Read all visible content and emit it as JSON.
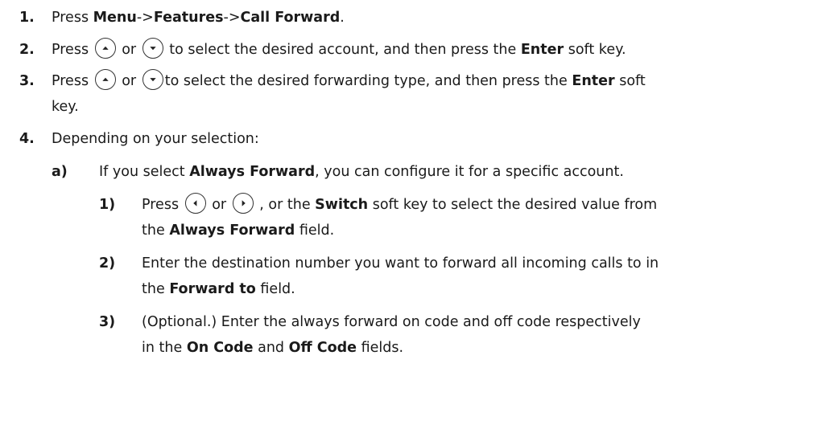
{
  "icons": {
    "up": "arrow-up-key-icon",
    "down": "arrow-down-key-icon",
    "left": "arrow-left-key-icon",
    "right": "arrow-right-key-icon"
  },
  "steps": [
    {
      "number": "1.",
      "press": "Press",
      "menu": "Menu",
      "sep1": "->",
      "features": "Features",
      "sep2": "->",
      "call_forward": "Call Forward",
      "end": "."
    },
    {
      "number": "2.",
      "press": "Press",
      "or": "or",
      "text": "to select the desired account, and then press the",
      "enter": "Enter",
      "end": "soft key."
    },
    {
      "number": "3.",
      "press": "Press",
      "or": "or",
      "text": "to select the desired forwarding type, and then press the",
      "enter": "Enter",
      "end": "soft",
      "cont": "key."
    },
    {
      "number": "4.",
      "text": "Depending on your selection:"
    }
  ],
  "sub": {
    "letter": "a)",
    "text1": "If you select",
    "always_forward": "Always Forward",
    "text2": ", you can configure it for a specific account.",
    "items": [
      {
        "number": "1)",
        "press": "Press",
        "or1": "or",
        "or2": ", or the",
        "switch": "Switch",
        "text": "soft key to select the desired value from",
        "line2_pre": "the",
        "line2_bold": "Always Forward",
        "line2_post": "field."
      },
      {
        "number": "2)",
        "line1": "Enter the destination number you want to forward all incoming calls to in",
        "line2_pre": "the",
        "line2_bold": "Forward to",
        "line2_post": "field."
      },
      {
        "number": "3)",
        "line1": "(Optional.) Enter the always forward on code and off code respectively",
        "line2_pre": "in the",
        "on_code": "On Code",
        "and": "and",
        "off_code": "Off Code",
        "line2_post": "fields."
      }
    ]
  }
}
